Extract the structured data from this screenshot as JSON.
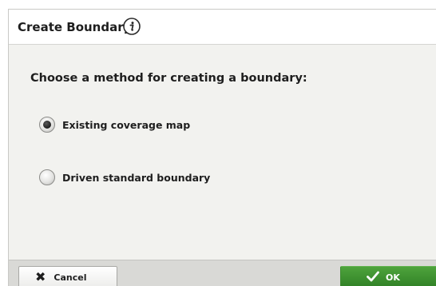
{
  "dialog": {
    "title": "Create Boundary",
    "info_icon": "info-icon",
    "prompt": "Choose a method for creating a boundary:",
    "options": [
      {
        "label": "Existing coverage map",
        "selected": true
      },
      {
        "label": "Driven standard boundary",
        "selected": false
      }
    ],
    "buttons": {
      "cancel_label": "Cancel",
      "cancel_icon": "close-icon",
      "ok_label": "OK",
      "ok_icon": "check-icon"
    }
  },
  "colors": {
    "ok_green": "#2f7f25",
    "title_background": "#ffffff",
    "content_background": "#f2f2ef",
    "button_bar": "#d9d9d6"
  }
}
